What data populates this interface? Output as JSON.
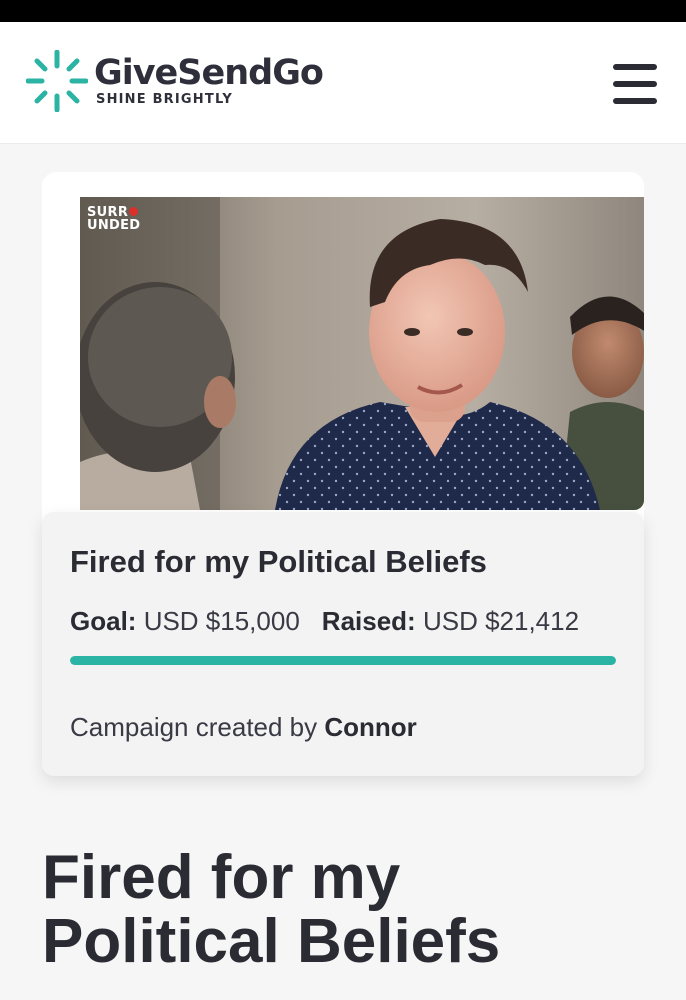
{
  "brand": {
    "name": "GiveSendGo",
    "tagline": "SHINE BRIGHTLY",
    "accent_color": "#2bb3a3"
  },
  "header": {
    "menu_icon": "hamburger-menu-icon"
  },
  "media": {
    "watermark_line1": "SURR",
    "watermark_line2": "UNDED"
  },
  "campaign": {
    "card_title": "Fired for my Political Beliefs",
    "goal_label": "Goal:",
    "goal_value": "USD $15,000",
    "raised_label": "Raised:",
    "raised_value": "USD $21,412",
    "progress_fraction": 1.0,
    "created_by_label": "Campaign created by",
    "creator_name": "Connor",
    "page_title": "Fired for my Political Beliefs"
  }
}
